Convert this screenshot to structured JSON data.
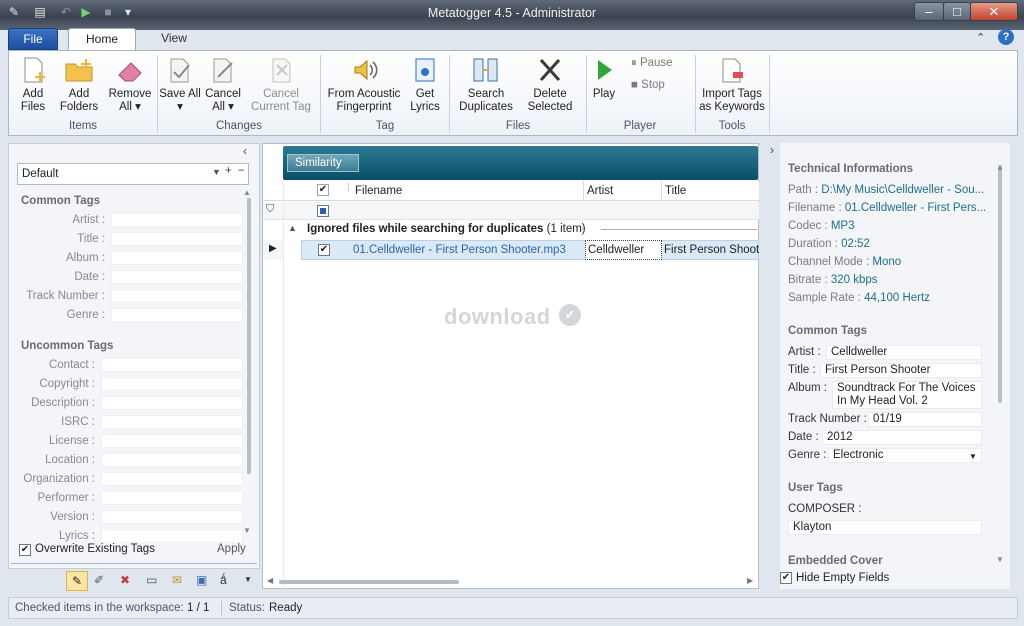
{
  "window": {
    "title": "Metatogger 4.5 - Administrator"
  },
  "tabs": {
    "file": "File",
    "home": "Home",
    "view": "View"
  },
  "ribbon": {
    "add_files": "Add Files",
    "add_folders": "Add Folders",
    "remove_all": "Remove All ▾",
    "group_items": "Items",
    "save_all": "Save All ▾",
    "cancel_all": "Cancel All ▾",
    "cancel_current_tag": "Cancel Current Tag",
    "group_changes": "Changes",
    "from_acoustic": "From Acoustic Fingerprint",
    "get_lyrics": "Get Lyrics",
    "group_tag": "Tag",
    "search_duplicates": "Search Duplicates",
    "delete_selected": "Delete Selected",
    "group_files": "Files",
    "play": "Play",
    "pause": "Pause",
    "stop": "Stop",
    "group_player": "Player",
    "import_tags": "Import Tags as Keywords",
    "group_tools": "Tools"
  },
  "left": {
    "preset": "Default",
    "common_title": "Common Tags",
    "common": [
      "Artist :",
      "Title :",
      "Album :",
      "Date :",
      "Track Number :",
      "Genre :"
    ],
    "uncommon_title": "Uncommon Tags",
    "uncommon": [
      "Contact :",
      "Copyright :",
      "Description :",
      "ISRC :",
      "License :",
      "Location :",
      "Organization :",
      "Performer :",
      "Version :",
      "Lyrics :"
    ],
    "overwrite": "Overwrite Existing Tags",
    "apply": "Apply"
  },
  "center": {
    "similarity": "Similarity",
    "columns": {
      "filename": "Filename",
      "artist": "Artist",
      "title": "Title"
    },
    "group_label": "Ignored files while searching for duplicates",
    "group_count": "(1 item)",
    "row": {
      "filename": "01.Celldweller - First Person Shooter.mp3",
      "artist": "Celldweller",
      "title": "First Person Shoot"
    },
    "watermark": "download"
  },
  "right": {
    "tech_title": "Technical Informations",
    "path_l": "Path :",
    "path_v": "D:\\My Music\\Celldweller - Sou...",
    "filename_l": "Filename :",
    "filename_v": "01.Celldweller - First Pers...",
    "codec_l": "Codec :",
    "codec_v": "MP3",
    "duration_l": "Duration :",
    "duration_v": "02:52",
    "channel_l": "Channel Mode :",
    "channel_v": "Mono",
    "bitrate_l": "Bitrate :",
    "bitrate_v": "320 kbps",
    "sample_l": "Sample Rate :",
    "sample_v": "44,100 Hertz",
    "common_title": "Common Tags",
    "artist_l": "Artist :",
    "artist_v": "Celldweller",
    "title_l": "Title :",
    "title_v": "First Person Shooter",
    "album_l": "Album :",
    "album_v1": "Soundtrack For The Voices",
    "album_v2": "In My Head Vol. 2",
    "track_l": "Track Number :",
    "track_v": "01/19",
    "date_l": "Date :",
    "date_v": "2012",
    "genre_l": "Genre :",
    "genre_v": "Electronic",
    "user_title": "User Tags",
    "composer_l": "COMPOSER :",
    "composer_v": "Klayton",
    "embedded": "Embedded Cover",
    "hide_empty": "Hide Empty Fields"
  },
  "status": {
    "checked_label": "Checked items in the workspace:",
    "checked_value": "1 / 1",
    "status_label": "Status:",
    "status_value": "Ready"
  }
}
